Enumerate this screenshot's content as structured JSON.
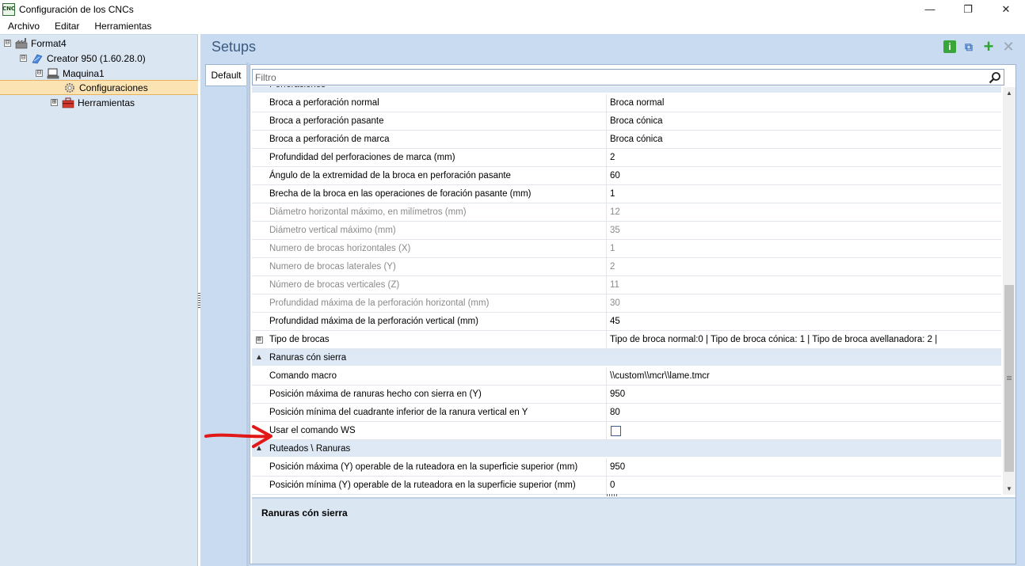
{
  "window": {
    "app_icon_text": "CNC",
    "title": "Configuración de los CNCs",
    "controls": {
      "minimize": "—",
      "maximize": "❐",
      "close": "✕"
    }
  },
  "menubar": {
    "items": [
      "Archivo",
      "Editar",
      "Herramientas"
    ]
  },
  "tree": {
    "nodes": [
      {
        "label": "Format4",
        "expander": "⊟",
        "icon": "factory-icon"
      },
      {
        "label": "Creator 950 (1.60.28.0)",
        "expander": "⊟",
        "icon": "cnc-machine-icon"
      },
      {
        "label": "Maquina1",
        "expander": "⊟",
        "icon": "computer-icon"
      },
      {
        "label": "Configuraciones",
        "expander": "",
        "icon": "gear-icon",
        "selected": true
      },
      {
        "label": "Herramientas",
        "expander": "⊞",
        "icon": "toolbox-icon"
      }
    ]
  },
  "panel": {
    "title": "Setups",
    "toolbar": {
      "info": "i",
      "copy": "⧉",
      "add": "+",
      "remove": "✕"
    },
    "tab_label": "Default",
    "filter_placeholder": "Filtro",
    "description_title": "Ranuras cón sierra"
  },
  "grid": {
    "categories": [
      {
        "label": "Perforacióness",
        "caret": "▲"
      }
    ],
    "sections": [
      {
        "category": "Perforaciónes",
        "rows": [
          {
            "name": "Broca a perforación normal",
            "value": "Broca normal",
            "disabled": false
          },
          {
            "name": "Broca a perforación pasante",
            "value": "Broca cónica",
            "disabled": false
          },
          {
            "name": "Broca a perforación de marca",
            "value": "Broca cónica",
            "disabled": false
          },
          {
            "name": "Profundidad del perforaciones de marca (mm)",
            "value": "2",
            "disabled": false
          },
          {
            "name": "Ángulo de la extremidad de la broca en perforación pasante",
            "value": "60",
            "disabled": false
          },
          {
            "name": "Brecha de la broca en las operaciones de foración pasante (mm)",
            "value": "1",
            "disabled": false
          },
          {
            "name": "Diámetro horizontal máximo, en milímetros (mm)",
            "value": "12",
            "disabled": true
          },
          {
            "name": "Diámetro vertical máximo (mm)",
            "value": "35",
            "disabled": true
          },
          {
            "name": "Numero de brocas horizontales (X)",
            "value": "1",
            "disabled": true
          },
          {
            "name": "Numero de brocas laterales (Y)",
            "value": "2",
            "disabled": true
          },
          {
            "name": "Número de brocas verticales (Z)",
            "value": "11",
            "disabled": true
          },
          {
            "name": "Profundidad máxima de la perforación horizontal (mm)",
            "value": "30",
            "disabled": true
          },
          {
            "name": "Profundidad máxima de la perforación vertical (mm)",
            "value": "45",
            "disabled": false
          },
          {
            "name": "Tipo de brocas",
            "value": "Tipo de broca normal:0  |  Tipo de broca cónica: 1  |  Tipo de broca avellanadora: 2  |",
            "disabled": false,
            "expandable": "⊞"
          }
        ]
      },
      {
        "category": "Ranuras cón sierra",
        "rows": [
          {
            "name": "Comando macro",
            "value": "\\\\custom\\\\mcr\\\\lame.tmcr",
            "disabled": false
          },
          {
            "name": "Posición máxima de ranuras hecho con sierra en (Y)",
            "value": "950",
            "disabled": false
          },
          {
            "name": "Posición mínima del cuadrante inferior de la ranura vertical en Y",
            "value": "80",
            "disabled": false
          },
          {
            "name": "Usar el comando WS",
            "value": "",
            "checkbox": true,
            "checked": false,
            "disabled": false
          }
        ]
      },
      {
        "category": "Ruteados \\ Ranuras",
        "rows": [
          {
            "name": "Posición máxima (Y) operable de la ruteadora en la superficie superior (mm)",
            "value": "950",
            "disabled": false
          },
          {
            "name": "Posición mínima (Y) operable de la ruteadora en la superficie superior (mm)",
            "value": "0",
            "disabled": false
          }
        ]
      }
    ],
    "caret": "▲"
  },
  "colors": {
    "accent_title": "#3a5a80",
    "selection": "#fbe3b3",
    "annotation_arrow": "#e01818"
  }
}
